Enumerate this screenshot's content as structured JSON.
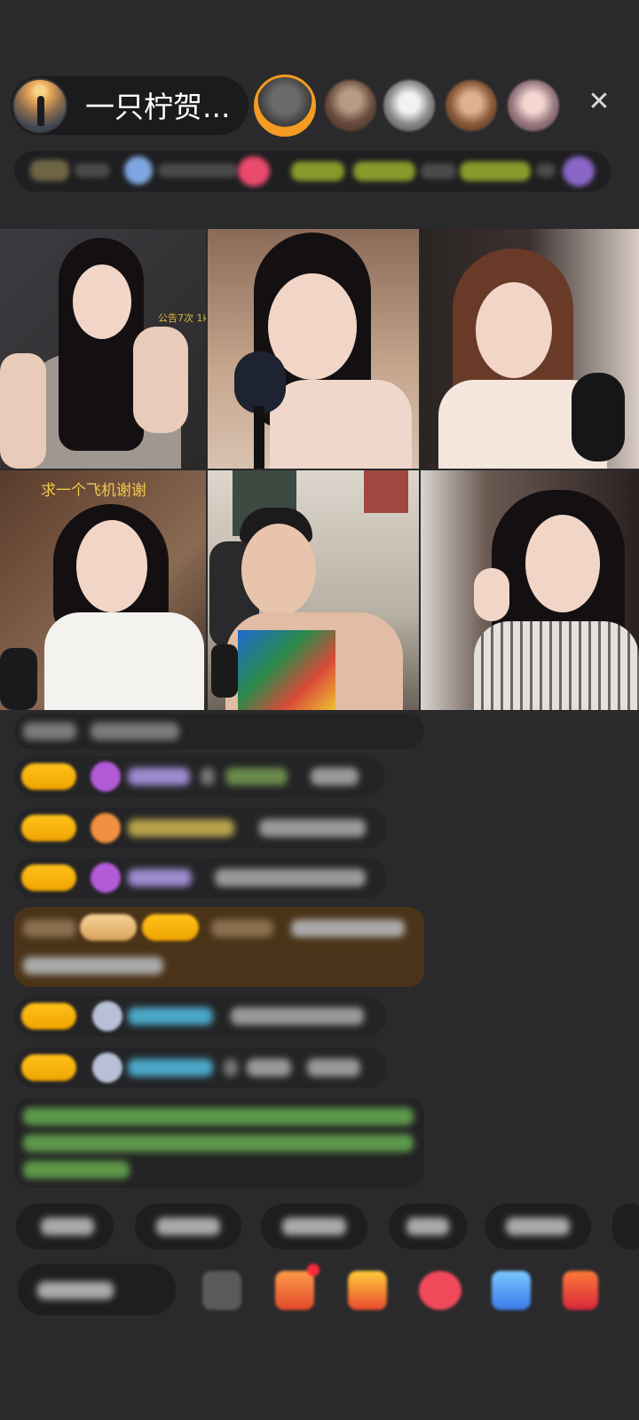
{
  "header": {
    "host_name": "一只柠贺...",
    "close_label": "✕"
  },
  "grid": {
    "caption_tile4": "求一个飞机谢谢",
    "caption_tile1": "公告7次 1k"
  },
  "colors": {
    "background": "#2a2a2c",
    "badge": "#f5b20e",
    "highlight_row": "#4a3318",
    "active_viewer_ring": "#f39b22"
  }
}
